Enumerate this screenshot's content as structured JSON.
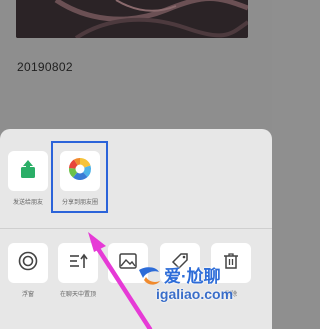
{
  "post": {
    "date": "20190802"
  },
  "share_sheet": {
    "row1": [
      {
        "label": "发送给朋友",
        "icon": "share-up-arrow-icon"
      },
      {
        "label": "分享到朋友圈",
        "icon": "moments-aperture-icon"
      }
    ],
    "row2": [
      {
        "label": "浮窗",
        "icon": "float-window-icon"
      },
      {
        "label": "在聊天中置顶",
        "icon": "pin-top-icon"
      },
      {
        "label": "",
        "icon": "image-icon"
      },
      {
        "label": "",
        "icon": "tag-icon"
      },
      {
        "label": "删除",
        "icon": "trash-icon"
      }
    ]
  },
  "watermark": {
    "title": "爱·尬聊",
    "url": "igaliao.com"
  },
  "colors": {
    "highlight": "#2b63d9",
    "arrow": "#e63ad6",
    "share_green": "#2aae67"
  }
}
